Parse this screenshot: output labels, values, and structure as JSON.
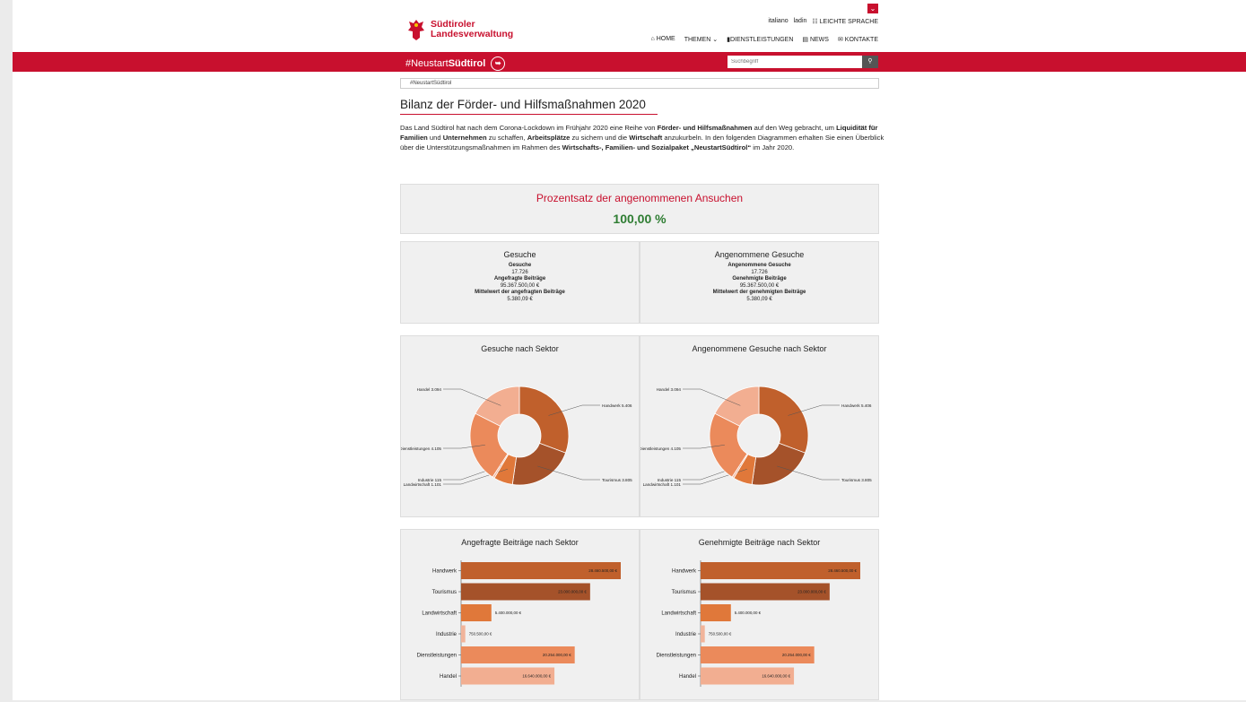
{
  "header": {
    "logo_line1": "Südtiroler",
    "logo_line2": "Landesverwaltung",
    "lang_italiano": "italiano",
    "lang_ladin": "ladin",
    "lang_easy": "LEICHTE SPRACHE",
    "nav": {
      "home": "HOME",
      "themen": "THEMEN",
      "dienstleistungen": "DIENSTLEISTUNGEN",
      "news": "NEWS",
      "kontakte": "KONTAKTE"
    },
    "brand_prefix": "#Neustart",
    "brand_bold": "Südtirol",
    "search_placeholder": "Suchbegriff"
  },
  "breadcrumb": "#NeustartSüdtirol",
  "page_title": "Bilanz der Förder- und Hilfsmaßnahmen 2020",
  "intro": {
    "t1": "Das Land Südtirol hat nach dem Corona-Lockdown im Frühjahr 2020 eine Reihe von ",
    "b1": "Förder- und Hilfsmaßnahmen",
    "t2": " auf den Weg gebracht, um ",
    "b2": "Liquidität für Familien",
    "t3": " und ",
    "b3": "Unternehmen",
    "t4": " zu schaffen, ",
    "b4": "Arbeitsplätze",
    "t5": " zu sichern und die ",
    "b5": "Wirtschaft",
    "t6": " anzukurbeln. In den folgenden Diagrammen erhalten Sie einen Überblick über die Unterstützungsmaßnahmen im Rahmen des ",
    "b6": "Wirtschafts-, Familien- und Sozialpaket „NeustartSüdtirol“",
    "t7": " im Jahr 2020."
  },
  "kpi": {
    "title": "Prozentsatz der angenommenen Ansuchen",
    "value": "100,00 %"
  },
  "stats_left": {
    "title": "Gesuche",
    "l1": "Gesuche",
    "v1": "17.726",
    "l2": "Angefragte Beiträge",
    "v2": "95.367.500,00 €",
    "l3": "Mittelwert der angefragten Beiträge",
    "v3": "5.380,09 €"
  },
  "stats_right": {
    "title": "Angenommene Gesuche",
    "l1": "Angenommene Gesuche",
    "v1": "17.726",
    "l2": "Genehmigte Beiträge",
    "v2": "95.367.500,00 €",
    "l3": "Mittelwert der genehmigten Beiträge",
    "v3": "5.380,09 €"
  },
  "colors": {
    "Handwerk": "#c0602c",
    "Tourismus": "#a5522a",
    "Landwirtschaft": "#e0783a",
    "Industrie": "#f1b49a",
    "Dienstleistungen": "#eb8a5b",
    "Handel": "#f2ae91"
  },
  "chart_data": [
    {
      "type": "pie",
      "title": "Gesuche nach Sektor",
      "labels": [
        "Handwerk 5.406",
        "Tourismus 3.805",
        "Landwirtschaft 1.101",
        "Industrie 115",
        "Dienstleistungen 4.105",
        "Handel 3.094"
      ],
      "categories": [
        "Handwerk",
        "Tourismus",
        "Landwirtschaft",
        "Industrie",
        "Dienstleistungen",
        "Handel"
      ],
      "values": [
        5406,
        3805,
        1101,
        115,
        4105,
        3094
      ]
    },
    {
      "type": "pie",
      "title": "Angenommene Gesuche nach Sektor",
      "labels": [
        "Handwerk 5.406",
        "Tourismus 3.805",
        "Landwirtschaft 1.101",
        "Industrie 115",
        "Dienstleistungen 4.105",
        "Handel 3.094"
      ],
      "categories": [
        "Handwerk",
        "Tourismus",
        "Landwirtschaft",
        "Industrie",
        "Dienstleistungen",
        "Handel"
      ],
      "values": [
        5406,
        3805,
        1101,
        115,
        4105,
        3094
      ]
    },
    {
      "type": "bar",
      "title": "Angefragte Beiträge nach Sektor",
      "categories": [
        "Handwerk",
        "Tourismus",
        "Landwirtschaft",
        "Industrie",
        "Dienstleistungen",
        "Handel"
      ],
      "values": [
        28460500,
        23000000,
        5400000,
        750500,
        20254000,
        16640000
      ],
      "labels": [
        "28.460.500,00 €",
        "23.000.000,00 €",
        "5.400.000,00 €",
        "750.500,00 €",
        "20.254.000,00 €",
        "16.640.000,00 €"
      ]
    },
    {
      "type": "bar",
      "title": "Genehmigte Beiträge nach Sektor",
      "categories": [
        "Handwerk",
        "Tourismus",
        "Landwirtschaft",
        "Industrie",
        "Dienstleistungen",
        "Handel"
      ],
      "values": [
        28460500,
        23000000,
        5400000,
        750500,
        20254000,
        16640000
      ],
      "labels": [
        "28.460.500,00 €",
        "23.000.000,00 €",
        "5.400.000,00 €",
        "750.500,00 €",
        "20.254.000,00 €",
        "16.640.000,00 €"
      ]
    }
  ]
}
